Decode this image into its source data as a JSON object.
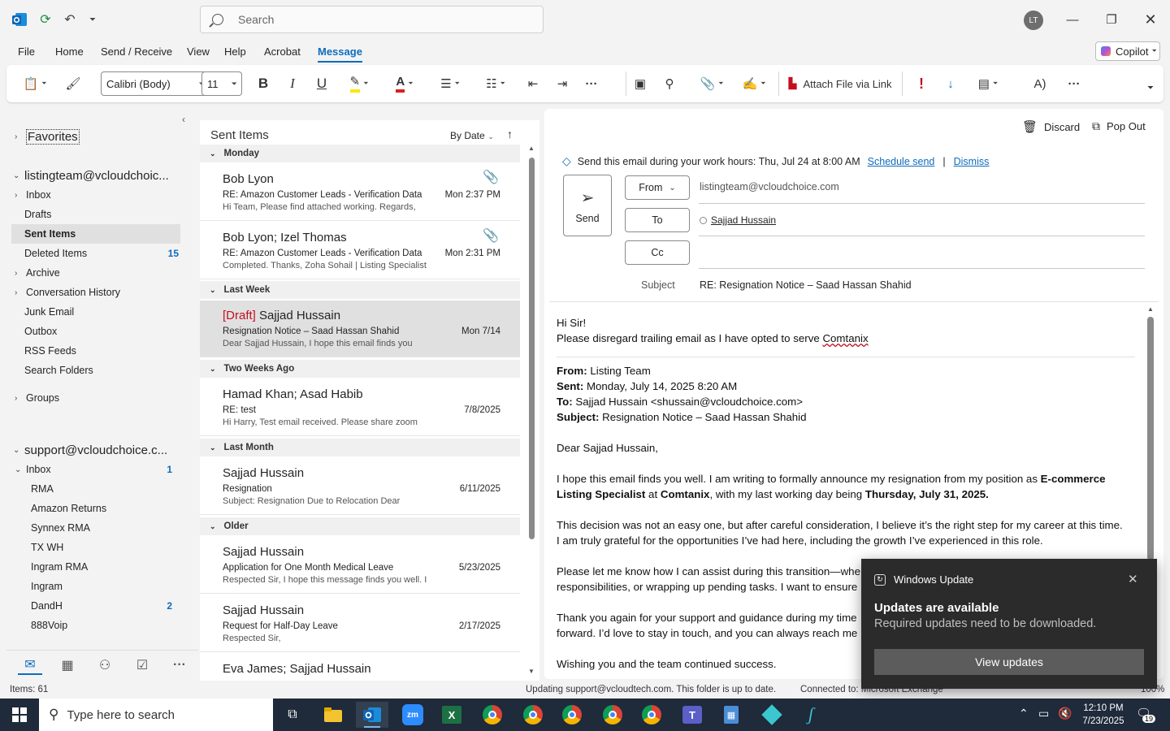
{
  "titlebar": {
    "search_placeholder": "Search",
    "avatar": "LT"
  },
  "menu": {
    "tabs": [
      "File",
      "Home",
      "Send / Receive",
      "View",
      "Help",
      "Acrobat",
      "Message"
    ],
    "copilot": "Copilot"
  },
  "ribbon": {
    "font": "Calibri (Body)",
    "size": "11",
    "attach_link": "Attach File via Link"
  },
  "folders": {
    "favorites": "Favorites",
    "account1": "listingteam@vcloudchoic...",
    "items1": [
      {
        "label": "Inbox",
        "count": ""
      },
      {
        "label": "Drafts",
        "count": ""
      },
      {
        "label": "Sent Items",
        "count": ""
      },
      {
        "label": "Deleted Items",
        "count": "15"
      },
      {
        "label": "Archive",
        "count": ""
      },
      {
        "label": "Conversation History",
        "count": ""
      },
      {
        "label": "Junk Email",
        "count": ""
      },
      {
        "label": "Outbox",
        "count": ""
      },
      {
        "label": "RSS Feeds",
        "count": ""
      },
      {
        "label": "Search Folders",
        "count": ""
      }
    ],
    "groups": "Groups",
    "account2": "support@vcloudchoice.c...",
    "items2": [
      {
        "label": "Inbox",
        "count": "1"
      },
      {
        "label": "RMA",
        "count": ""
      },
      {
        "label": "Amazon Returns",
        "count": ""
      },
      {
        "label": "Synnex RMA",
        "count": ""
      },
      {
        "label": "TX WH",
        "count": ""
      },
      {
        "label": "Ingram RMA",
        "count": ""
      },
      {
        "label": "Ingram",
        "count": ""
      },
      {
        "label": "DandH",
        "count": "2"
      },
      {
        "label": "888Voip",
        "count": ""
      }
    ]
  },
  "list": {
    "title": "Sent Items",
    "sort": "By Date",
    "groups": [
      "Monday",
      "Last Week",
      "Two Weeks Ago",
      "Last Month",
      "Older"
    ],
    "items": [
      {
        "draft": "",
        "sender": "Bob Lyon",
        "subject": "RE: Amazon Customer Leads -  Verification Data",
        "preview": "Hi Team,  Please find attached working.  Regards,",
        "date": "Mon 2:37 PM"
      },
      {
        "draft": "",
        "sender": "Bob Lyon; Izel Thomas",
        "subject": "RE: Amazon Customer Leads -  Verification Data",
        "preview": "Completed.  Thanks,  Zoha Sohail | Listing Specialist",
        "date": "Mon 2:31 PM"
      },
      {
        "draft": "[Draft]",
        "sender": " Sajjad Hussain",
        "subject": "Resignation Notice – Saad Hassan Shahid",
        "preview": "Dear Sajjad Hussain,  I hope this email finds you",
        "date": "Mon 7/14"
      },
      {
        "draft": "",
        "sender": "Hamad Khan; Asad Habib",
        "subject": "RE: test",
        "preview": "Hi Harry,   Test email received. Please share zoom",
        "date": "7/8/2025"
      },
      {
        "draft": "",
        "sender": "Sajjad Hussain",
        "subject": "Resignation",
        "preview": "Subject: Resignation Due to Relocation  Dear",
        "date": "6/11/2025"
      },
      {
        "draft": "",
        "sender": "Sajjad Hussain",
        "subject": "Application for One Month Medical Leave",
        "preview": "Respected Sir,  I hope this message finds you well. I",
        "date": "5/23/2025"
      },
      {
        "draft": "",
        "sender": "Sajjad Hussain",
        "subject": "Request for Half-Day Leave",
        "preview": "Respected Sir,",
        "date": "2/17/2025"
      },
      {
        "draft": "",
        "sender": "Eva James; Sajjad Hussain",
        "subject": "",
        "preview": "",
        "date": ""
      }
    ]
  },
  "compose": {
    "discard": "Discard",
    "popout": "Pop Out",
    "notice": "Send this email during your work hours: Thu, Jul 24 at 8:00 AM",
    "schedule": "Schedule send",
    "sep": "|",
    "dismiss": "Dismiss",
    "send": "Send",
    "from_btn": "From",
    "from_value": "listingteam@vcloudchoice.com",
    "to_btn": "To",
    "to_value": "Sajjad Hussain",
    "cc_btn": "Cc",
    "subject_label": "Subject",
    "subject_value": "RE:  Resignation Notice – Saad Hassan Shahid"
  },
  "body": {
    "l1": "Hi Sir!",
    "l2a": "Please disregard trailing email as I have opted to serve ",
    "l2b": "Comtanix",
    "from_l": "From:",
    "from_v": " Listing Team",
    "sent_l": "Sent:",
    "sent_v": " Monday, July 14, 2025 8:20 AM",
    "to_l": "To:",
    "to_v": " Sajjad Hussain <shussain@vcloudchoice.com>",
    "subj_l": "Subject:",
    "subj_v": " Resignation Notice – Saad Hassan Shahid",
    "greet": "Dear Sajjad Hussain,",
    "p1a": "I hope this email finds you well. I am writing to formally announce my resignation from my position as ",
    "p1b": "E-commerce Listing Specialist",
    "p1c": " at ",
    "p1d": "Comtanix",
    "p1e": ", with my last working day being ",
    "p1f": "Thursday, July 31, 2025.",
    "p2a": "This decision was not an easy one, but after careful consideration, I believe it’s the right step for my career at this time.",
    "p2b": "I am truly grateful for the opportunities I’ve had here, including the growth I’ve experienced in this role.",
    "p3a": "Please let me know how I can assist during this transition—whe",
    "p3b": "responsibilities, or wrapping up pending tasks. I want to ensure",
    "p4a": "Thank you again for your support and guidance during my time",
    "p4b": "forward. I’d love to stay in touch, and you can always reach me",
    "p5": "Wishing you and the team continued success."
  },
  "status": {
    "items": "Items: 61",
    "updating": "Updating support@vcloudtech.com.  This folder is up to date.",
    "connected": "Connected to: Microsoft Exchange",
    "zoom": "100%"
  },
  "toast": {
    "app": "Windows Update",
    "title": "Updates are available",
    "text": "Required updates need to be downloaded.",
    "button": "View updates"
  },
  "taskbar": {
    "search": "Type here to search",
    "time": "12:10 PM",
    "date": "7/23/2025",
    "notif": "19"
  },
  "colors": {
    "accent": "#0f6cbd",
    "draft": "#c50f1f",
    "taskbar": "#1f2a3a"
  }
}
